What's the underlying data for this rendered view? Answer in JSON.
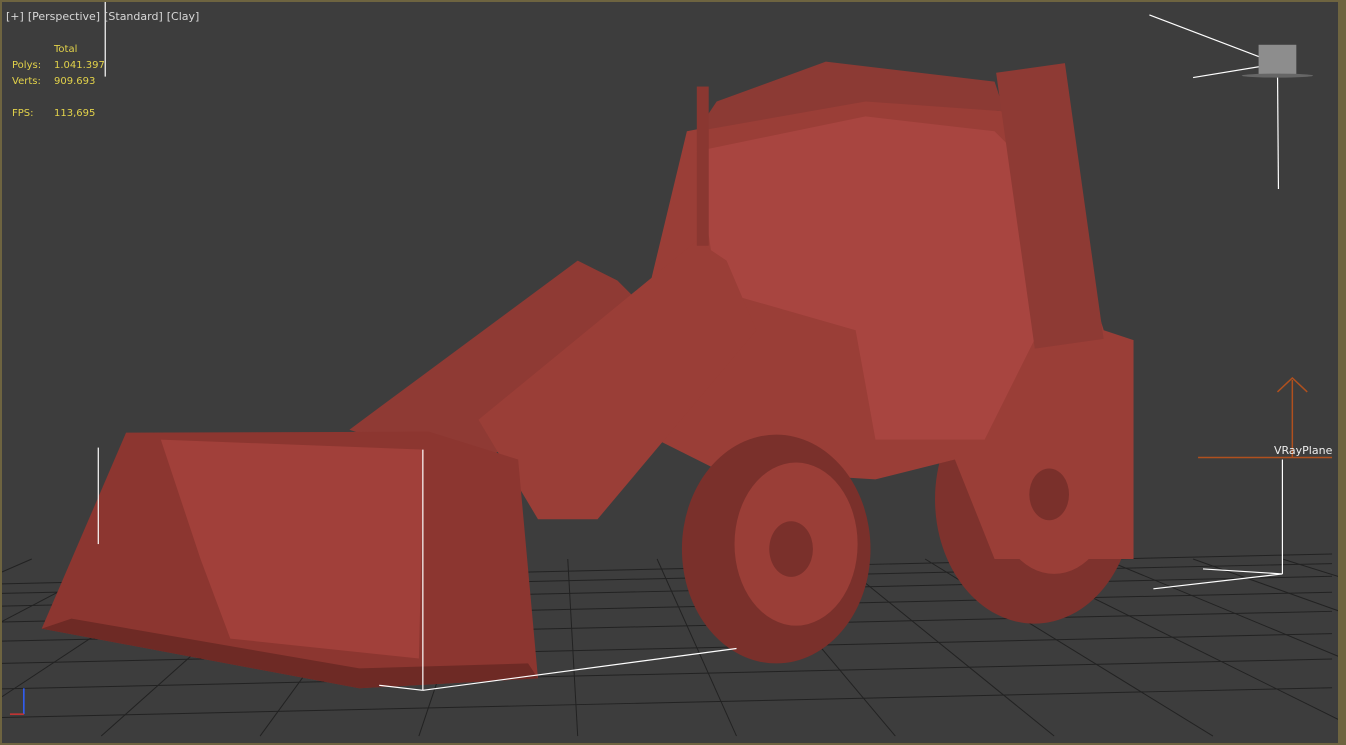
{
  "viewport": {
    "labels": [
      "[+]",
      "[Perspective]",
      "[Standard]",
      "[Clay]"
    ]
  },
  "stats": {
    "header": "Total",
    "polys_label": "Polys:",
    "polys_value": "1.041.397",
    "verts_label": "Verts:",
    "verts_value": "909.693",
    "fps_label": "FPS:",
    "fps_value": "113,695"
  },
  "scene": {
    "object_label": "VRayPlane",
    "model_color": "#9a3e37",
    "stats_color": "#e2d24a",
    "border_color": "#6e6440"
  }
}
